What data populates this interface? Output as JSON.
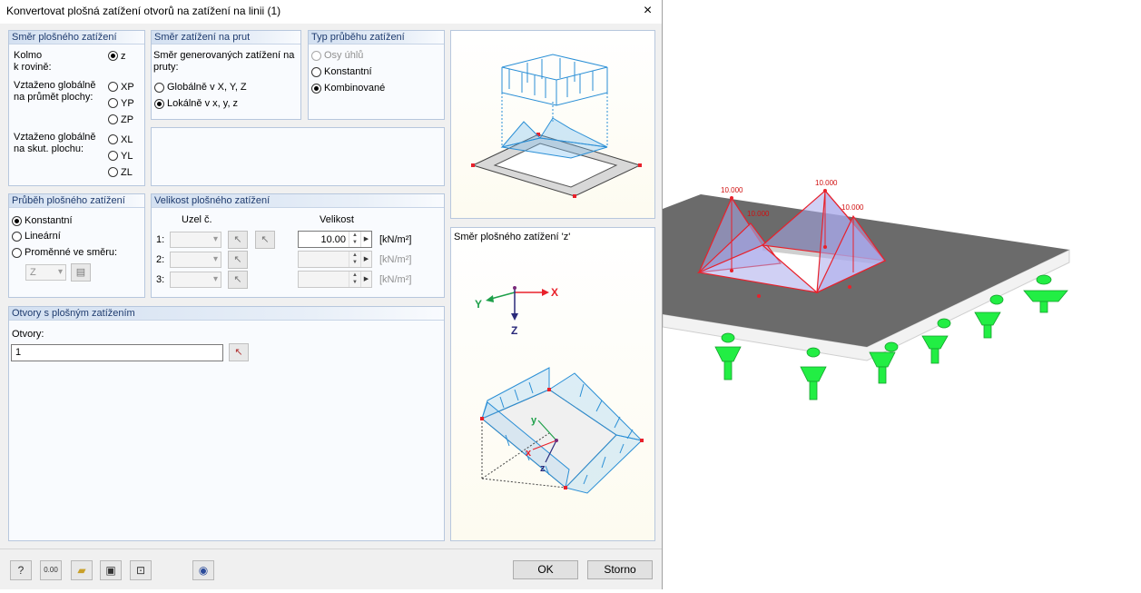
{
  "dialog": {
    "title": "Konvertovat plošná zatížení otvorů na zatížení na linii   (1)",
    "close": "×"
  },
  "smer_plosneho": {
    "title": "Směr plošného zatížení",
    "kolmo": "Kolmo\nk rovině:",
    "opt_z": "z",
    "globalne_prumet": "Vztaženo globálně\nna průmět plochy:",
    "opt_xp": "XP",
    "opt_yp": "YP",
    "opt_zp": "ZP",
    "globalne_skut": "Vztaženo globálně\nna skut. plochu:",
    "opt_xl": "XL",
    "opt_yl": "YL",
    "opt_zl": "ZL"
  },
  "smer_na_prut": {
    "title": "Směr zatížení na prut",
    "desc": "Směr generovaných zatížení na\npruty:",
    "opt_global": "Globálně v X, Y, Z",
    "opt_local": "Lokálně v x, y, z"
  },
  "typ_prubehu": {
    "title": "Typ průběhu zatížení",
    "opt_osy": "Osy úhlů",
    "opt_konst": "Konstantní",
    "opt_komb": "Kombinované"
  },
  "prubeh_plosneho": {
    "title": "Průběh plošného zatížení",
    "opt_konst": "Konstantní",
    "opt_lin": "Lineární",
    "opt_prom": "Proměnné ve směru:",
    "dir_value": "Z"
  },
  "velikost": {
    "title": "Velikost plošného zatížení",
    "col_uzel": "Uzel č.",
    "col_velikost": "Velikost",
    "rows": [
      {
        "label": "1:",
        "value": "10.00",
        "unit": "[kN/m²]"
      },
      {
        "label": "2:",
        "value": "",
        "unit": "[kN/m²]"
      },
      {
        "label": "3:",
        "value": "",
        "unit": "[kN/m²]"
      }
    ]
  },
  "otvory": {
    "title": "Otvory s plošným zatížením",
    "label": "Otvory:",
    "value": "1"
  },
  "preview2": {
    "caption": "Směr plošného zatížení 'z'",
    "axis_y": "Y",
    "axis_x": "X",
    "axis_z": "Z",
    "local_y": "y",
    "local_x": "x",
    "local_z": "z"
  },
  "model": {
    "labels": [
      "10.000",
      "10.000",
      "10.000",
      "10.000"
    ]
  },
  "footer": {
    "ok": "OK",
    "cancel": "Storno",
    "icons": [
      "help-icon",
      "units-icon",
      "open-icon",
      "save-icon",
      "preview-icon",
      "eye-icon"
    ]
  },
  "colors": {
    "group_header_text": "#1e3b6e",
    "load_blue": "#2a8fd6",
    "support_green": "#22ee44",
    "load_red": "#e8212b",
    "slab_gray": "#6b6b6b"
  }
}
